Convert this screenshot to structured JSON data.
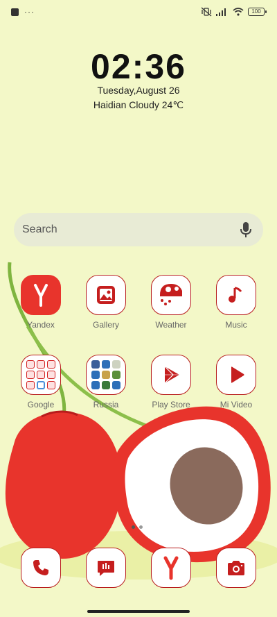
{
  "status_bar": {
    "battery": "100"
  },
  "lockscreen": {
    "time": "02:36",
    "date": "Tuesday,August 26",
    "weather": "Haidian Cloudy 24℃"
  },
  "search": {
    "placeholder": "Search"
  },
  "apps": {
    "row1": [
      {
        "label": "Yandex",
        "icon": "yandex-icon"
      },
      {
        "label": "Gallery",
        "icon": "gallery-icon"
      },
      {
        "label": "Weather",
        "icon": "weather-icon"
      },
      {
        "label": "Music",
        "icon": "music-icon"
      }
    ],
    "row2": [
      {
        "label": "Google",
        "icon": "google-folder-icon"
      },
      {
        "label": "Russia",
        "icon": "russia-folder-icon"
      },
      {
        "label": "Play Store",
        "icon": "play-store-icon"
      },
      {
        "label": "Mi Video",
        "icon": "mi-video-icon"
      }
    ]
  },
  "dock": [
    {
      "icon": "phone-icon"
    },
    {
      "icon": "messages-icon"
    },
    {
      "icon": "yandex-browser-icon"
    },
    {
      "icon": "camera-icon"
    }
  ],
  "colors": {
    "background": "#f3f8c8",
    "accent": "#d32020",
    "lychee": "#e8342c"
  }
}
